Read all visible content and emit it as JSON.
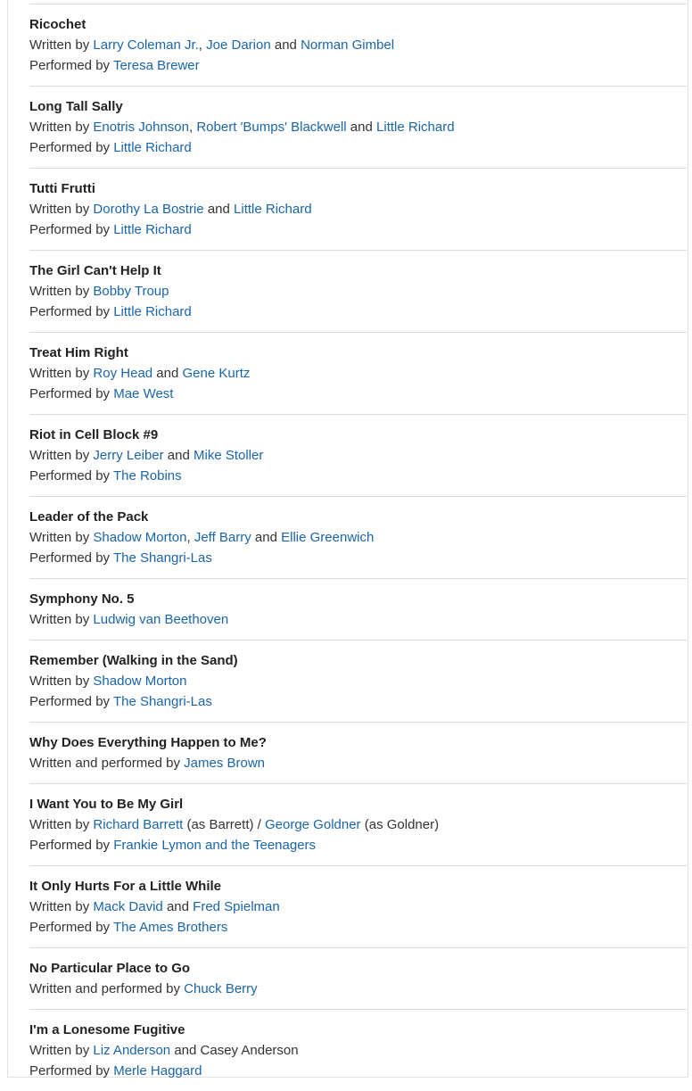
{
  "entries": [
    {
      "title": "Ricochet",
      "lines": [
        [
          {
            "t": "Written by "
          },
          {
            "t": "Larry Coleman Jr.",
            "link": true
          },
          {
            "t": ", "
          },
          {
            "t": "Joe Darion",
            "link": true
          },
          {
            "t": " and "
          },
          {
            "t": "Norman Gimbel",
            "link": true
          }
        ],
        [
          {
            "t": "Performed by "
          },
          {
            "t": "Teresa Brewer",
            "link": true
          }
        ]
      ]
    },
    {
      "title": "Long Tall Sally",
      "lines": [
        [
          {
            "t": "Written by "
          },
          {
            "t": "Enotris Johnson",
            "link": true
          },
          {
            "t": ", "
          },
          {
            "t": "Robert 'Bumps' Blackwell",
            "link": true
          },
          {
            "t": " and "
          },
          {
            "t": "Little Richard",
            "link": true
          }
        ],
        [
          {
            "t": "Performed by "
          },
          {
            "t": "Little Richard",
            "link": true
          }
        ]
      ]
    },
    {
      "title": "Tutti Frutti",
      "lines": [
        [
          {
            "t": "Written by "
          },
          {
            "t": "Dorothy La Bostrie",
            "link": true
          },
          {
            "t": " and "
          },
          {
            "t": "Little Richard",
            "link": true
          }
        ],
        [
          {
            "t": "Performed by "
          },
          {
            "t": "Little Richard",
            "link": true
          }
        ]
      ]
    },
    {
      "title": "The Girl Can't Help It",
      "lines": [
        [
          {
            "t": "Written by "
          },
          {
            "t": "Bobby Troup",
            "link": true
          }
        ],
        [
          {
            "t": "Performed by "
          },
          {
            "t": "Little Richard",
            "link": true
          }
        ]
      ]
    },
    {
      "title": "Treat Him Right",
      "lines": [
        [
          {
            "t": "Written by "
          },
          {
            "t": "Roy Head",
            "link": true
          },
          {
            "t": " and "
          },
          {
            "t": "Gene Kurtz",
            "link": true
          }
        ],
        [
          {
            "t": "Performed by "
          },
          {
            "t": "Mae West",
            "link": true
          }
        ]
      ]
    },
    {
      "title": "Riot in Cell Block #9",
      "lines": [
        [
          {
            "t": "Written by "
          },
          {
            "t": "Jerry Leiber",
            "link": true
          },
          {
            "t": " and "
          },
          {
            "t": "Mike Stoller",
            "link": true
          }
        ],
        [
          {
            "t": "Performed by "
          },
          {
            "t": "The Robins",
            "link": true
          }
        ]
      ]
    },
    {
      "title": "Leader of the Pack",
      "lines": [
        [
          {
            "t": "Written by "
          },
          {
            "t": "Shadow Morton",
            "link": true
          },
          {
            "t": ", "
          },
          {
            "t": "Jeff Barry",
            "link": true
          },
          {
            "t": " and "
          },
          {
            "t": "Ellie Greenwich",
            "link": true
          }
        ],
        [
          {
            "t": "Performed by "
          },
          {
            "t": "The Shangri-Las",
            "link": true
          }
        ]
      ]
    },
    {
      "title": "Symphony No. 5",
      "lines": [
        [
          {
            "t": "Written by "
          },
          {
            "t": "Ludwig van Beethoven",
            "link": true
          }
        ]
      ]
    },
    {
      "title": "Remember (Walking in the Sand)",
      "lines": [
        [
          {
            "t": "Written by "
          },
          {
            "t": "Shadow Morton",
            "link": true
          }
        ],
        [
          {
            "t": "Performed by "
          },
          {
            "t": "The Shangri-Las",
            "link": true
          }
        ]
      ]
    },
    {
      "title": "Why Does Everything Happen to Me?",
      "lines": [
        [
          {
            "t": "Written and performed by "
          },
          {
            "t": "James Brown",
            "link": true
          }
        ]
      ]
    },
    {
      "title": "I Want You to Be My Girl",
      "lines": [
        [
          {
            "t": "Written by "
          },
          {
            "t": "Richard Barrett",
            "link": true
          },
          {
            "t": " (as Barrett) / "
          },
          {
            "t": "George Goldner",
            "link": true
          },
          {
            "t": " (as Goldner)"
          }
        ],
        [
          {
            "t": "Performed by "
          },
          {
            "t": "Frankie Lymon and the Teenagers",
            "link": true
          }
        ]
      ]
    },
    {
      "title": "It Only Hurts For a Little While",
      "lines": [
        [
          {
            "t": "Written by "
          },
          {
            "t": "Mack David",
            "link": true
          },
          {
            "t": " and "
          },
          {
            "t": "Fred Spielman",
            "link": true
          }
        ],
        [
          {
            "t": "Performed by "
          },
          {
            "t": "The Ames Brothers",
            "link": true
          }
        ]
      ]
    },
    {
      "title": "No Particular Place to Go",
      "lines": [
        [
          {
            "t": "Written and performed by "
          },
          {
            "t": "Chuck Berry",
            "link": true
          }
        ]
      ]
    },
    {
      "title": "I'm a Lonesome Fugitive",
      "lines": [
        [
          {
            "t": "Written by "
          },
          {
            "t": "Liz Anderson",
            "link": true
          },
          {
            "t": " and Casey Anderson"
          }
        ],
        [
          {
            "t": "Performed by "
          },
          {
            "t": "Merle Haggard",
            "link": true
          }
        ]
      ]
    }
  ],
  "colors": {
    "link": "#1a65a8",
    "text": "#333333",
    "title": "#222222",
    "divider": "#dcdcdc"
  }
}
